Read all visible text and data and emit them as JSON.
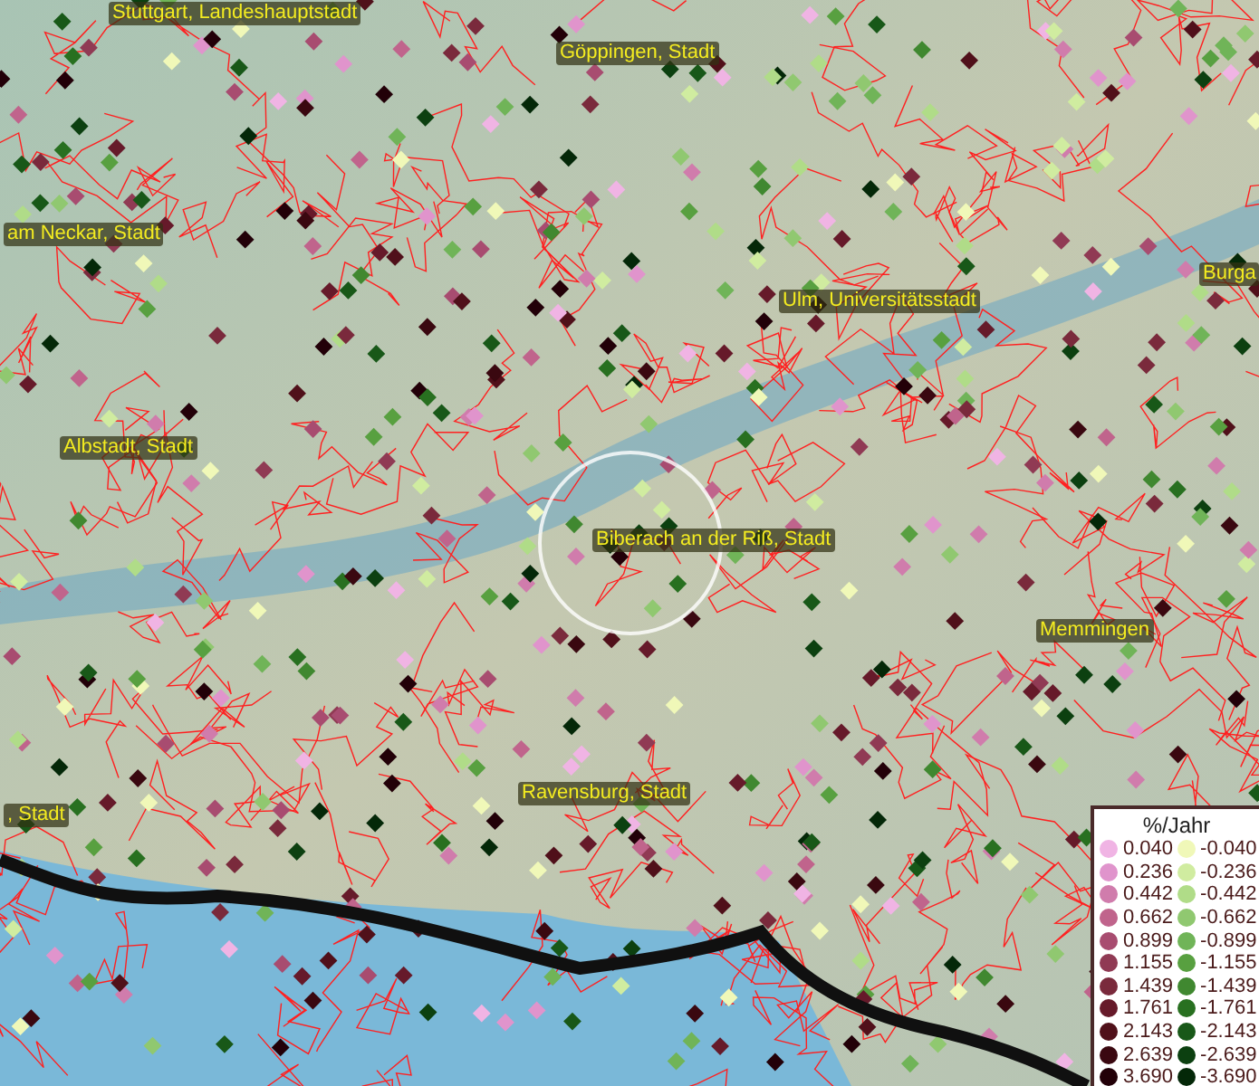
{
  "map": {
    "places": [
      {
        "name": "Stuttgart, Landeshauptstadt"
      },
      {
        "name": "Göppingen, Stadt"
      },
      {
        "name": "am Neckar, Stadt"
      },
      {
        "name": "Ulm, Universitätsstadt"
      },
      {
        "name": "Burga"
      },
      {
        "name": "Albstadt, Stadt"
      },
      {
        "name": "Biberach an der Riß, Stadt"
      },
      {
        "name": "Memmingen"
      },
      {
        "name": "Ravensburg, Stadt"
      },
      {
        "name": ", Stadt"
      }
    ]
  },
  "legend": {
    "title": "%/Jahr",
    "columns": [
      [
        {
          "label": "0.040",
          "color": "#f0b4e4"
        },
        {
          "label": "0.236",
          "color": "#e094cc"
        },
        {
          "label": "0.442",
          "color": "#d07cac"
        },
        {
          "label": "0.662",
          "color": "#c0648c"
        },
        {
          "label": "0.899",
          "color": "#a84c70"
        },
        {
          "label": "1.155",
          "color": "#903a54"
        },
        {
          "label": "1.439",
          "color": "#7a2a3c"
        },
        {
          "label": "1.761",
          "color": "#661a2a"
        },
        {
          "label": "2.143",
          "color": "#50101a"
        },
        {
          "label": "2.639",
          "color": "#3a0810"
        },
        {
          "label": "3.690",
          "color": "#220008"
        }
      ],
      [
        {
          "label": "-0.040",
          "color": "#f0f8b8"
        },
        {
          "label": "-0.236",
          "color": "#d0eca0"
        },
        {
          "label": "-0.442",
          "color": "#b0dc88"
        },
        {
          "label": "-0.662",
          "color": "#90c870"
        },
        {
          "label": "-0.899",
          "color": "#70b458"
        },
        {
          "label": "-1.155",
          "color": "#58a040"
        },
        {
          "label": "-1.439",
          "color": "#408830"
        },
        {
          "label": "-1.761",
          "color": "#287020"
        },
        {
          "label": "-2.143",
          "color": "#185818"
        },
        {
          "label": "-2.639",
          "color": "#0c4010"
        },
        {
          "label": "-3.690",
          "color": "#042808"
        }
      ]
    ]
  }
}
